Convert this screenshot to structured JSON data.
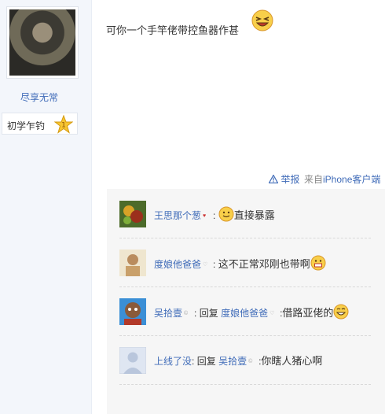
{
  "author": {
    "username": "尽享无常",
    "level_title": "初学乍钓",
    "level_number": "1"
  },
  "post": {
    "text": "可你一个手竿佬带控鱼器作甚"
  },
  "footer": {
    "report_label": "举报",
    "source_prefix": "来自",
    "source_client": "iPhone客户端"
  },
  "comments": [
    {
      "name": "王思那个葱",
      "separator": ":",
      "text": "直接暴露",
      "reply_prefix": "",
      "reply_target": "",
      "reply_sep": ""
    },
    {
      "name": "度娘他爸爸",
      "separator": ":",
      "text": "这不正常邓刚也带啊",
      "reply_prefix": "",
      "reply_target": "",
      "reply_sep": ""
    },
    {
      "name": "吴拾壹",
      "separator": ":",
      "reply_prefix": "回复",
      "reply_target": "度娘他爸爸",
      "reply_sep": ":",
      "text": "借路亚佬的"
    },
    {
      "name": "上线了没",
      "separator": ":",
      "reply_prefix": "回复",
      "reply_target": "吴拾壹",
      "reply_sep": ":",
      "text": "你瞎人猪心啊"
    }
  ],
  "colors": {
    "link": "#3f6bb8",
    "sidebar_bg": "#f3f6fb",
    "comment_bg": "#f6f6f6"
  }
}
